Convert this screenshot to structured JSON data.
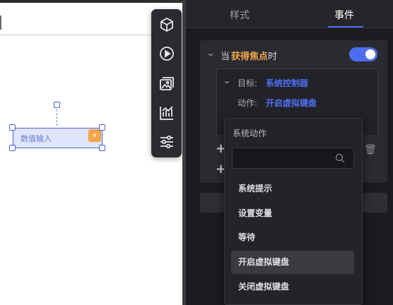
{
  "panel": {
    "tabs": [
      {
        "label": "样式",
        "active": false
      },
      {
        "label": "事件",
        "active": true
      }
    ]
  },
  "event": {
    "prefix": "当",
    "trigger": "获得焦点",
    "suffix": "时",
    "enabled": true,
    "target_key": "目标:",
    "target_value": "系统控制器",
    "action_key": "动作:",
    "action_value": "开启虚拟键盘"
  },
  "canvas": {
    "widget_label": "数值输入"
  },
  "toolbar": {
    "tools": [
      "cube-icon",
      "play-icon",
      "gallery-icon",
      "chart-icon",
      "sliders-icon"
    ]
  },
  "dropdown": {
    "title": "系统动作",
    "search_placeholder": "",
    "items": [
      {
        "label": "系统提示",
        "active": false
      },
      {
        "label": "设置变量",
        "active": false
      },
      {
        "label": "等待",
        "active": false
      },
      {
        "label": "开启虚拟键盘",
        "active": true
      },
      {
        "label": "关闭虚拟键盘",
        "active": false
      }
    ]
  },
  "colors": {
    "accent": "#4e6ef2",
    "highlight": "#f5a547",
    "panel_bg": "#1b1c1f"
  }
}
